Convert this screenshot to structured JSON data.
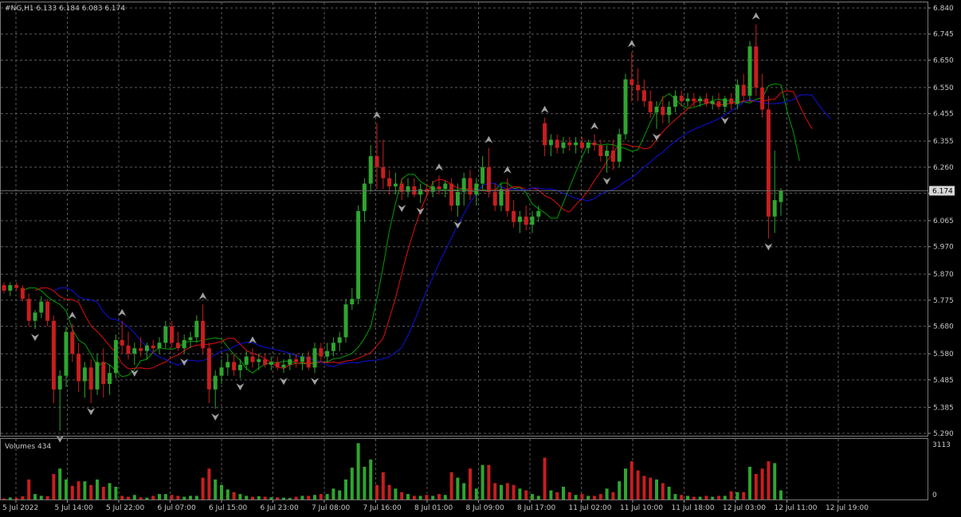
{
  "symbol_info": "#NG,H1  6.133 6.184 6.083 6.174",
  "volume_label": "Volumes 434",
  "current_price_label": "6.174",
  "current_price": 6.174,
  "volume_axis": {
    "max_label": "3113",
    "min_label": "0",
    "max": 3113
  },
  "colors": {
    "background": "#000000",
    "grid": "#5a5a5a",
    "axis_text": "#c8c8c8",
    "bull": "#2fa52f",
    "bear": "#c81e1e",
    "ma_fast": "#00a000",
    "ma_mid": "#e01010",
    "ma_slow": "#1010e0",
    "fractal": "#a0a0a0"
  },
  "chart_data": {
    "type": "candlestick",
    "symbol": "#NG",
    "timeframe": "H1",
    "price_axis": {
      "ticks": [
        "6.840",
        "6.745",
        "6.650",
        "6.550",
        "6.455",
        "6.355",
        "6.260",
        "6.165",
        "6.065",
        "5.970",
        "5.870",
        "5.775",
        "5.680",
        "5.580",
        "5.485",
        "5.385",
        "5.290"
      ],
      "range": [
        5.29,
        6.84
      ]
    },
    "time_axis": {
      "ticks": [
        "5 Jul 2022",
        "5 Jul 14:00",
        "5 Jul 22:00",
        "6 Jul 07:00",
        "6 Jul 15:00",
        "6 Jul 23:00",
        "7 Jul 08:00",
        "7 Jul 16:00",
        "8 Jul 01:00",
        "8 Jul 09:00",
        "8 Jul 17:00",
        "11 Jul 02:00",
        "11 Jul 10:00",
        "11 Jul 18:00",
        "12 Jul 03:00",
        "12 Jul 11:00",
        "12 Jul 19:00"
      ]
    },
    "candles": [
      [
        5.83,
        5.84,
        5.8,
        5.81
      ],
      [
        5.81,
        5.84,
        5.79,
        5.83
      ],
      [
        5.83,
        5.84,
        5.81,
        5.82
      ],
      [
        5.82,
        5.83,
        5.77,
        5.78
      ],
      [
        5.78,
        5.8,
        5.68,
        5.7
      ],
      [
        5.7,
        5.74,
        5.67,
        5.73
      ],
      [
        5.73,
        5.79,
        5.71,
        5.77
      ],
      [
        5.77,
        5.78,
        5.68,
        5.7
      ],
      [
        5.7,
        5.72,
        5.4,
        5.45
      ],
      [
        5.45,
        5.52,
        5.3,
        5.5
      ],
      [
        5.5,
        5.68,
        5.46,
        5.66
      ],
      [
        5.66,
        5.69,
        5.55,
        5.58
      ],
      [
        5.58,
        5.62,
        5.44,
        5.48
      ],
      [
        5.48,
        5.55,
        5.42,
        5.53
      ],
      [
        5.53,
        5.56,
        5.4,
        5.45
      ],
      [
        5.45,
        5.58,
        5.43,
        5.55
      ],
      [
        5.55,
        5.6,
        5.42,
        5.47
      ],
      [
        5.47,
        5.54,
        5.43,
        5.51
      ],
      [
        5.51,
        5.65,
        5.49,
        5.63
      ],
      [
        5.63,
        5.7,
        5.58,
        5.61
      ],
      [
        5.61,
        5.66,
        5.56,
        5.58
      ],
      [
        5.58,
        5.62,
        5.54,
        5.6
      ],
      [
        5.6,
        5.64,
        5.57,
        5.59
      ],
      [
        5.59,
        5.62,
        5.56,
        5.61
      ],
      [
        5.61,
        5.63,
        5.58,
        5.6
      ],
      [
        5.6,
        5.64,
        5.58,
        5.62
      ],
      [
        5.62,
        5.7,
        5.6,
        5.68
      ],
      [
        5.68,
        5.7,
        5.6,
        5.62
      ],
      [
        5.62,
        5.66,
        5.59,
        5.6
      ],
      [
        5.6,
        5.65,
        5.58,
        5.63
      ],
      [
        5.63,
        5.66,
        5.6,
        5.64
      ],
      [
        5.64,
        5.72,
        5.62,
        5.7
      ],
      [
        5.7,
        5.76,
        5.58,
        5.6
      ],
      [
        5.6,
        5.62,
        5.4,
        5.45
      ],
      [
        5.45,
        5.52,
        5.38,
        5.5
      ],
      [
        5.5,
        5.56,
        5.47,
        5.53
      ],
      [
        5.53,
        5.58,
        5.5,
        5.55
      ],
      [
        5.55,
        5.58,
        5.5,
        5.52
      ],
      [
        5.52,
        5.56,
        5.49,
        5.54
      ],
      [
        5.54,
        5.59,
        5.52,
        5.57
      ],
      [
        5.57,
        5.6,
        5.53,
        5.55
      ],
      [
        5.55,
        5.58,
        5.52,
        5.56
      ],
      [
        5.56,
        5.58,
        5.53,
        5.54
      ],
      [
        5.54,
        5.57,
        5.52,
        5.55
      ],
      [
        5.55,
        5.57,
        5.52,
        5.53
      ],
      [
        5.53,
        5.56,
        5.51,
        5.54
      ],
      [
        5.54,
        5.58,
        5.52,
        5.56
      ],
      [
        5.56,
        5.58,
        5.53,
        5.55
      ],
      [
        5.55,
        5.58,
        5.52,
        5.57
      ],
      [
        5.57,
        5.59,
        5.52,
        5.53
      ],
      [
        5.53,
        5.62,
        5.51,
        5.6
      ],
      [
        5.6,
        5.62,
        5.55,
        5.57
      ],
      [
        5.57,
        5.62,
        5.55,
        5.59
      ],
      [
        5.59,
        5.64,
        5.57,
        5.62
      ],
      [
        5.62,
        5.66,
        5.59,
        5.64
      ],
      [
        5.64,
        5.78,
        5.62,
        5.76
      ],
      [
        5.76,
        5.82,
        5.74,
        5.78
      ],
      [
        5.78,
        6.12,
        5.76,
        6.1
      ],
      [
        6.1,
        6.22,
        6.06,
        6.2
      ],
      [
        6.2,
        6.34,
        6.17,
        6.3
      ],
      [
        6.3,
        6.42,
        6.18,
        6.26
      ],
      [
        6.26,
        6.36,
        6.18,
        6.22
      ],
      [
        6.22,
        6.25,
        6.16,
        6.19
      ],
      [
        6.19,
        6.24,
        6.16,
        6.2
      ],
      [
        6.2,
        6.22,
        6.14,
        6.17
      ],
      [
        6.17,
        6.22,
        6.15,
        6.19
      ],
      [
        6.19,
        6.22,
        6.15,
        6.16
      ],
      [
        6.16,
        6.2,
        6.13,
        6.18
      ],
      [
        6.18,
        6.2,
        6.15,
        6.17
      ],
      [
        6.17,
        6.21,
        6.15,
        6.19
      ],
      [
        6.19,
        6.23,
        6.16,
        6.18
      ],
      [
        6.18,
        6.21,
        6.15,
        6.2
      ],
      [
        6.2,
        6.22,
        6.1,
        6.12
      ],
      [
        6.12,
        6.2,
        6.08,
        6.17
      ],
      [
        6.17,
        6.24,
        6.12,
        6.22
      ],
      [
        6.22,
        6.25,
        6.14,
        6.16
      ],
      [
        6.16,
        6.22,
        6.12,
        6.2
      ],
      [
        6.2,
        6.3,
        6.18,
        6.26
      ],
      [
        6.26,
        6.33,
        6.15,
        6.17
      ],
      [
        6.17,
        6.2,
        6.1,
        6.12
      ],
      [
        6.12,
        6.2,
        6.1,
        6.18
      ],
      [
        6.18,
        6.22,
        6.08,
        6.1
      ],
      [
        6.1,
        6.14,
        6.04,
        6.06
      ],
      [
        6.06,
        6.1,
        6.02,
        6.08
      ],
      [
        6.08,
        6.12,
        6.03,
        6.05
      ],
      [
        6.05,
        6.1,
        6.02,
        6.08
      ],
      [
        6.08,
        6.12,
        6.06,
        6.1
      ],
      [
        6.42,
        6.44,
        6.3,
        6.34
      ],
      [
        6.34,
        6.38,
        6.3,
        6.36
      ],
      [
        6.36,
        6.38,
        6.31,
        6.33
      ],
      [
        6.33,
        6.37,
        6.31,
        6.35
      ],
      [
        6.35,
        6.37,
        6.32,
        6.34
      ],
      [
        6.34,
        6.37,
        6.31,
        6.35
      ],
      [
        6.35,
        6.37,
        6.32,
        6.33
      ],
      [
        6.33,
        6.36,
        6.31,
        6.35
      ],
      [
        6.35,
        6.38,
        6.32,
        6.34
      ],
      [
        6.34,
        6.36,
        6.28,
        6.3
      ],
      [
        6.3,
        6.34,
        6.24,
        6.32
      ],
      [
        6.32,
        6.36,
        6.25,
        6.28
      ],
      [
        6.28,
        6.4,
        6.26,
        6.38
      ],
      [
        6.38,
        6.6,
        6.36,
        6.58
      ],
      [
        6.58,
        6.68,
        6.5,
        6.56
      ],
      [
        6.56,
        6.62,
        6.5,
        6.54
      ],
      [
        6.54,
        6.58,
        6.48,
        6.5
      ],
      [
        6.5,
        6.54,
        6.44,
        6.46
      ],
      [
        6.46,
        6.5,
        6.4,
        6.48
      ],
      [
        6.48,
        6.52,
        6.42,
        6.45
      ],
      [
        6.45,
        6.5,
        6.42,
        6.48
      ],
      [
        6.48,
        6.54,
        6.46,
        6.52
      ],
      [
        6.52,
        6.54,
        6.48,
        6.5
      ],
      [
        6.5,
        6.53,
        6.48,
        6.51
      ],
      [
        6.51,
        6.53,
        6.48,
        6.5
      ],
      [
        6.5,
        6.52,
        6.48,
        6.51
      ],
      [
        6.51,
        6.53,
        6.48,
        6.49
      ],
      [
        6.49,
        6.52,
        6.47,
        6.5
      ],
      [
        6.5,
        6.53,
        6.47,
        6.48
      ],
      [
        6.48,
        6.52,
        6.46,
        6.51
      ],
      [
        6.51,
        6.53,
        6.47,
        6.49
      ],
      [
        6.49,
        6.58,
        6.47,
        6.56
      ],
      [
        6.56,
        6.6,
        6.5,
        6.52
      ],
      [
        6.52,
        6.72,
        6.5,
        6.7
      ],
      [
        6.7,
        6.78,
        6.52,
        6.55
      ],
      [
        6.55,
        6.6,
        6.44,
        6.47
      ],
      [
        6.47,
        6.52,
        6.0,
        6.08
      ],
      [
        6.08,
        6.32,
        6.02,
        6.14
      ],
      [
        6.133,
        6.184,
        6.083,
        6.174
      ]
    ],
    "volumes": [
      60,
      110,
      90,
      180,
      1100,
      300,
      200,
      180,
      1400,
      1700,
      1100,
      750,
      1000,
      1000,
      800,
      1100,
      700,
      900,
      700,
      200,
      150,
      250,
      120,
      100,
      200,
      300,
      300,
      250,
      200,
      150,
      200,
      200,
      1200,
      1700,
      1100,
      800,
      550,
      400,
      300,
      200,
      150,
      180,
      150,
      120,
      120,
      100,
      80,
      150,
      200,
      200,
      250,
      300,
      300,
      600,
      500,
      1100,
      1750,
      3100,
      1800,
      2200,
      800,
      1500,
      800,
      600,
      400,
      300,
      200,
      200,
      250,
      200,
      300,
      250,
      1500,
      1200,
      900,
      1700,
      600,
      1900,
      1900,
      900,
      800,
      900,
      800,
      600,
      500,
      300,
      200,
      2300,
      500,
      400,
      700,
      400,
      250,
      300,
      200,
      200,
      300,
      600,
      400,
      1000,
      1700,
      2100,
      1600,
      1300,
      1200,
      1100,
      900,
      700,
      300,
      250,
      200,
      150,
      150,
      200,
      150,
      200,
      200,
      450,
      400,
      400,
      1800,
      1400,
      1700,
      2100,
      2000,
      500
    ]
  }
}
